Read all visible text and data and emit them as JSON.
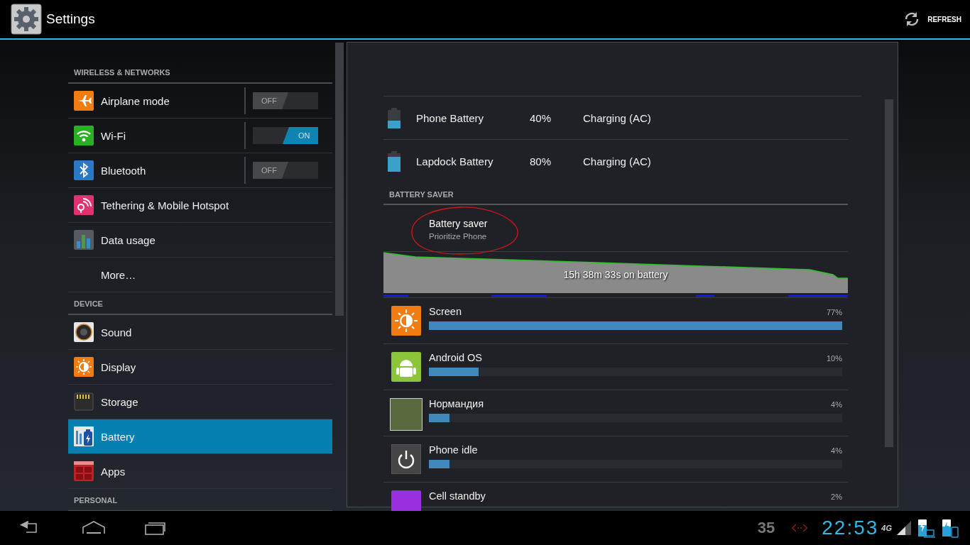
{
  "action_bar": {
    "title": "Settings",
    "action": "REFRESH"
  },
  "sidebar": {
    "sections": [
      {
        "title": "WIRELESS & NETWORKS",
        "items": [
          {
            "label": "Airplane mode",
            "selected": false,
            "toggle": {
              "on": false,
              "label": "OFF"
            }
          },
          {
            "label": "Wi-Fi",
            "selected": false,
            "toggle": {
              "on": true,
              "label": "ON"
            }
          },
          {
            "label": "Bluetooth",
            "selected": false,
            "toggle": {
              "on": false,
              "label": "OFF"
            }
          },
          {
            "label": "Tethering & Mobile Hotspot",
            "selected": false
          },
          {
            "label": "Data usage",
            "selected": false
          },
          {
            "label": "More…",
            "selected": false
          }
        ]
      },
      {
        "title": "DEVICE",
        "items": [
          {
            "label": "Sound",
            "selected": false
          },
          {
            "label": "Display",
            "selected": false
          },
          {
            "label": "Storage",
            "selected": false
          },
          {
            "label": "Battery",
            "selected": true
          },
          {
            "label": "Apps",
            "selected": false
          }
        ]
      },
      {
        "title": "PERSONAL"
      }
    ]
  },
  "batteries": [
    {
      "name": "Phone Battery",
      "percent": "40%",
      "status": "Charging (AC)",
      "level": 0.4
    },
    {
      "name": "Lapdock Battery",
      "percent": "80%",
      "status": "Charging (AC)",
      "level": 0.8
    }
  ],
  "battery_saver": {
    "header": "BATTERY SAVER",
    "title": "Battery saver",
    "summary": "Prioritize Phone"
  },
  "history": {
    "caption": "15h 38m 33s on battery"
  },
  "usage": [
    {
      "name": "Screen",
      "percent": "77%",
      "level": 1.0
    },
    {
      "name": "Android OS",
      "percent": "10%",
      "level": 0.12
    },
    {
      "name": "Нормандия",
      "percent": "4%",
      "level": 0.05
    },
    {
      "name": "Phone idle",
      "percent": "4%",
      "level": 0.05
    },
    {
      "name": "Cell standby",
      "percent": "2%"
    }
  ],
  "system_bar": {
    "notification_count": "35",
    "clock": "22:53",
    "network": "4G"
  }
}
